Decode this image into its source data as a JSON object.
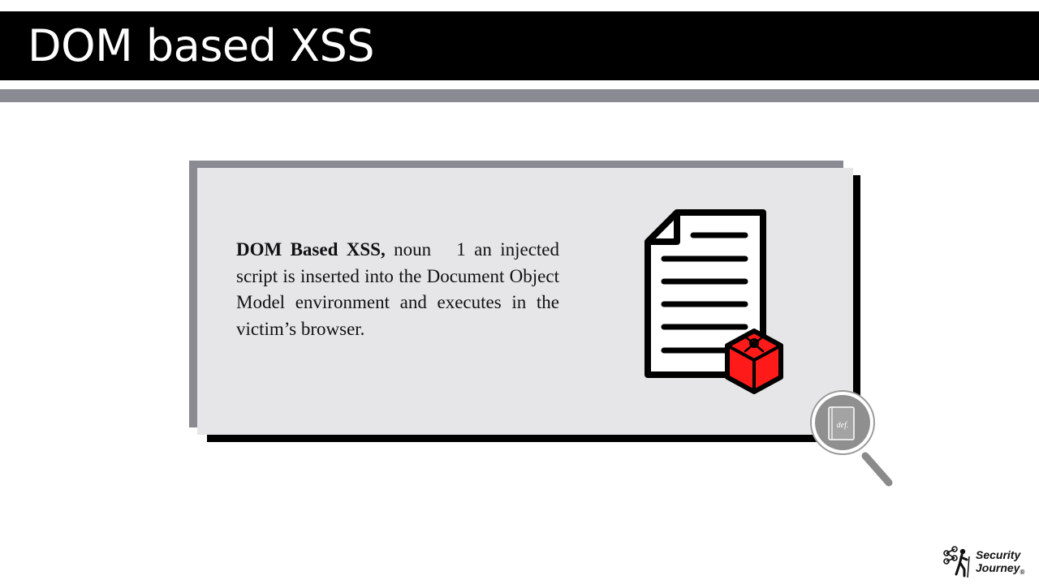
{
  "slide": {
    "title": "DOM based XSS"
  },
  "definition": {
    "term": "DOM Based XSS,",
    "part_of_speech": "noun",
    "sense_number": "1",
    "text": "an injected script is inserted into the Document Object Model environment and executes in the victim’s browser."
  },
  "icons": {
    "document": "document-icon",
    "malware_cube": "skull-crossbones-cube-icon",
    "magnifier": "magnifying-glass-icon",
    "magnifier_label": "def."
  },
  "brand": {
    "line1": "Security",
    "line2": "Journey",
    "registered": "®"
  },
  "colors": {
    "title_bar": "#000000",
    "accent_gray": "#898a92",
    "card_bg": "#e6e6e8",
    "threat_red": "#ff1a1a"
  }
}
